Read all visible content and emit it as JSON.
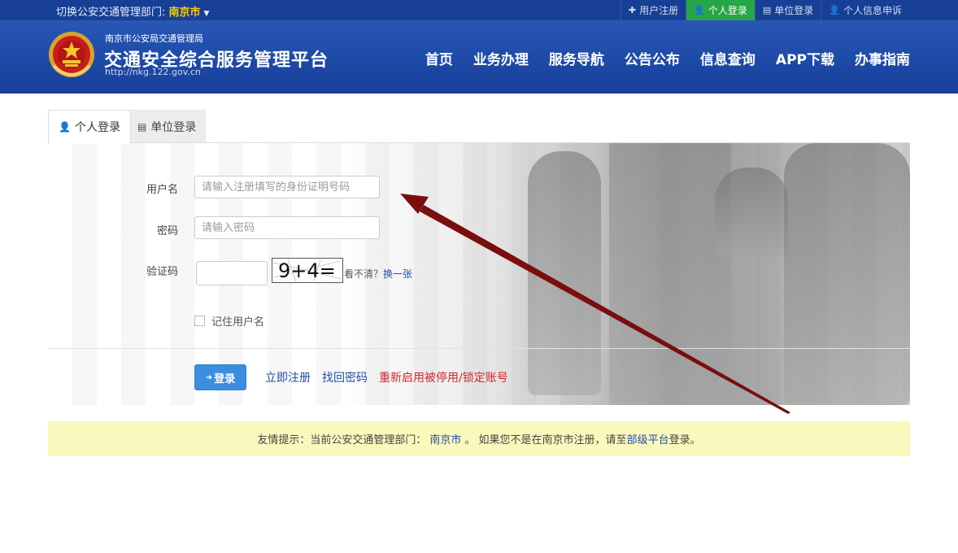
{
  "topbar": {
    "dept_prefix": "切换公安交通管理部门:",
    "city": "南京市",
    "links": [
      {
        "icon": "plus-icon",
        "label": "用户注册"
      },
      {
        "icon": "user-icon",
        "label": "个人登录"
      },
      {
        "icon": "building-icon",
        "label": "单位登录"
      },
      {
        "icon": "user-icon",
        "label": "个人信息申诉"
      }
    ]
  },
  "header": {
    "subtitle": "南京市公安局交通管理局",
    "title": "交通安全综合服务管理平台",
    "url": "http://nkg.122.gov.cn",
    "nav": [
      "首页",
      "业务办理",
      "服务导航",
      "公告公布",
      "信息查询",
      "APP下载",
      "办事指南"
    ]
  },
  "tabs": [
    {
      "icon": "user-icon",
      "label": "个人登录",
      "active": true
    },
    {
      "icon": "building-icon",
      "label": "单位登录",
      "active": false
    }
  ],
  "form": {
    "username_label": "用户名",
    "username_placeholder": "请输入注册填写的身份证明号码",
    "password_label": "密码",
    "password_placeholder": "请输入密码",
    "captcha_label": "验证码",
    "captcha_image_text": "9+4=",
    "cant_see_text": "看不清？",
    "refresh_link": "换一张",
    "remember_label": "记住用户名",
    "login_button": "登录",
    "register_link": "立即注册",
    "recover_link": "找回密码",
    "reactivate_link": "重新启用被停用/锁定账号"
  },
  "notice": {
    "prefix": "友情提示：当前公安交通管理部门：",
    "city": "南京市",
    "middle": "。 如果您不是在南京市注册，请至",
    "platform_link": "部级平台",
    "suffix": "登录。"
  },
  "colors": {
    "topbar": "#173f95",
    "header": "#1d4aa7",
    "active_green": "#26a647",
    "login_button": "#3c8dde",
    "link_blue": "#1f50a8",
    "link_red": "#d9222a",
    "notice_bg": "#fbf8bd",
    "annotation_arrow": "#7a0e0e"
  }
}
